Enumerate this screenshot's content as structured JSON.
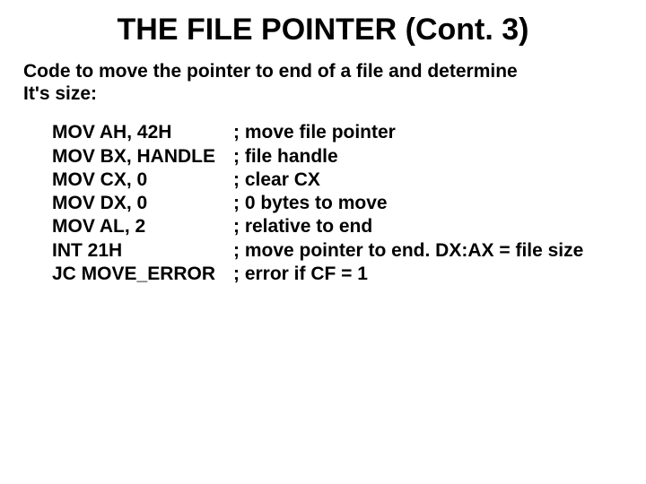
{
  "title": "THE FILE POINTER (Cont. 3)",
  "subtitle_line1": "Code to move the pointer to end of a file and determine",
  "subtitle_line2": "It's size:",
  "code": [
    {
      "instr": "MOV AH, 42H",
      "comment": "; move file pointer"
    },
    {
      "instr": "MOV BX, HANDLE",
      "comment": "; file handle"
    },
    {
      "instr": "MOV CX, 0",
      "comment": "; clear CX"
    },
    {
      "instr": "MOV DX, 0",
      "comment": "; 0 bytes to move"
    },
    {
      "instr": "MOV AL, 2",
      "comment": "; relative to end"
    },
    {
      "instr": "INT 21H",
      "comment": "; move pointer to end. DX:AX = file size"
    },
    {
      "instr": "JC MOVE_ERROR",
      "comment": "; error if CF = 1"
    }
  ]
}
